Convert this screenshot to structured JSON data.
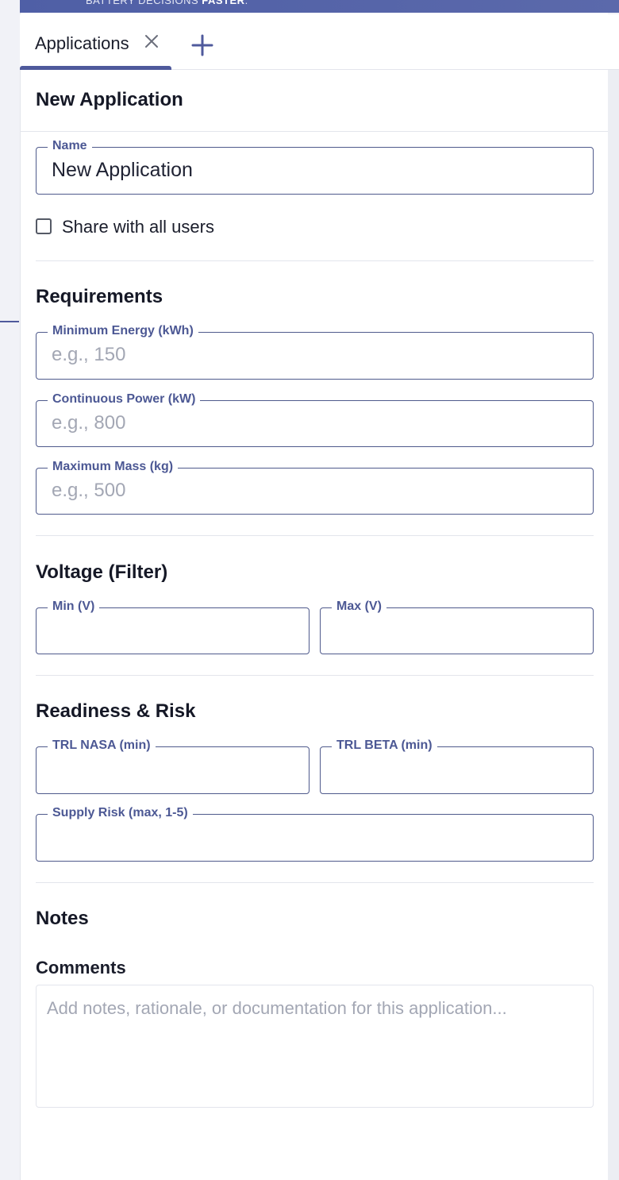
{
  "banner": {
    "text_prefix": "BATTERY DECISIONS ",
    "text_bold": "FASTER",
    "text_suffix": "."
  },
  "tabs": [
    {
      "label": "Applications"
    }
  ],
  "page_title": "New Application",
  "form": {
    "name": {
      "label": "Name",
      "value": "New Application"
    },
    "share": {
      "label": "Share with all users",
      "checked": false
    },
    "requirements": {
      "title": "Requirements",
      "min_energy": {
        "label": "Minimum Energy (kWh)",
        "placeholder": "e.g., 150"
      },
      "continuous_power": {
        "label": "Continuous Power (kW)",
        "placeholder": "e.g., 800"
      },
      "max_mass": {
        "label": "Maximum Mass (kg)",
        "placeholder": "e.g., 500"
      }
    },
    "voltage": {
      "title": "Voltage (Filter)",
      "min": {
        "label": "Min (V)"
      },
      "max": {
        "label": "Max (V)"
      }
    },
    "readiness": {
      "title": "Readiness & Risk",
      "trl_nasa": {
        "label": "TRL NASA (min)"
      },
      "trl_beta": {
        "label": "TRL BETA (min)"
      },
      "supply_risk": {
        "label": "Supply Risk (max, 1-5)"
      }
    },
    "notes": {
      "title": "Notes",
      "comments_label": "Comments",
      "comments_placeholder": "Add notes, rationale, or documentation for this application..."
    }
  },
  "colors": {
    "accent": "#4f5a9c",
    "label": "#4c5894",
    "border": "#4f5a8c",
    "placeholder": "#a3a7b4"
  },
  "icons": {
    "tab_close": "close-icon",
    "tab_add": "plus-icon"
  }
}
